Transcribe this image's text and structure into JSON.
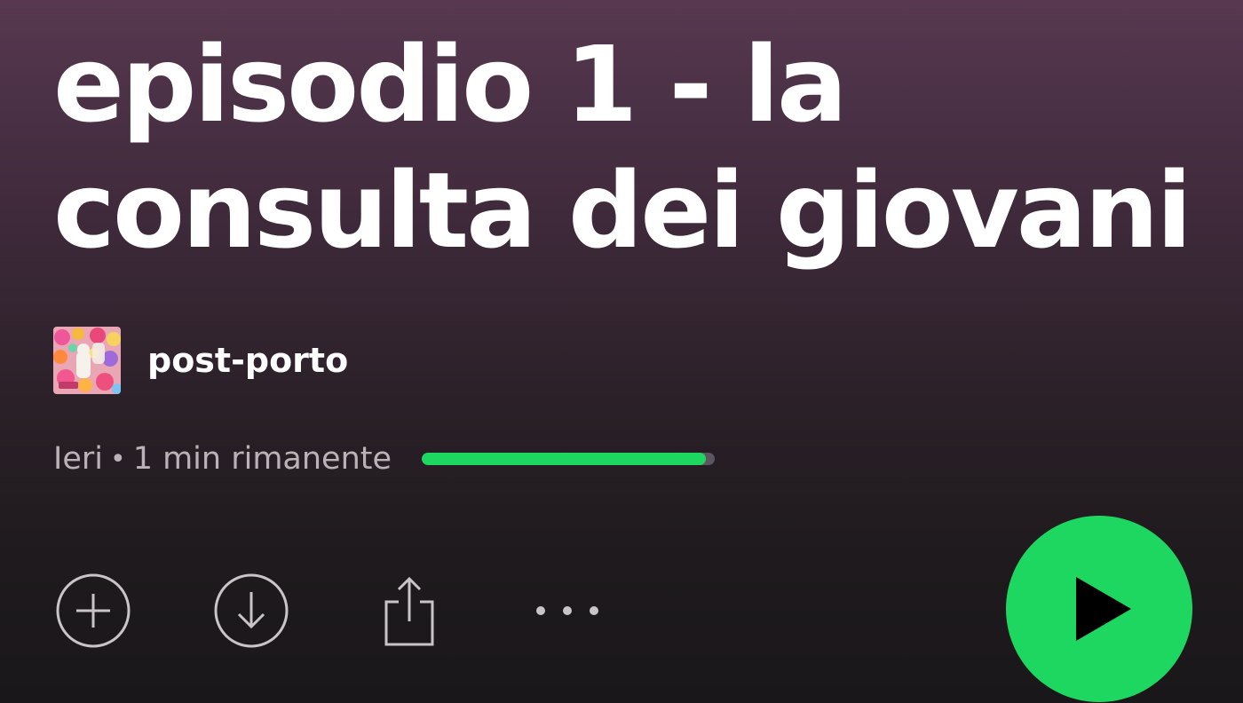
{
  "episode": {
    "title": "episodio 1 - la consulta dei giovani"
  },
  "show": {
    "name": "post-porto",
    "cover_icon": "podcast-cover-image"
  },
  "meta": {
    "date": "Ieri",
    "separator": "•",
    "remaining": "1 min rimanente",
    "progress": 0.97
  },
  "actions": {
    "add_icon": "plus-circle-icon",
    "download_icon": "download-circle-icon",
    "share_icon": "share-icon",
    "more_icon": "more-horizontal-icon",
    "play_icon": "play-icon"
  },
  "colors": {
    "accent": "#1ed760",
    "background_top": "#573850",
    "background_bottom": "#1a171a",
    "muted_text": "#b9b3b7"
  }
}
